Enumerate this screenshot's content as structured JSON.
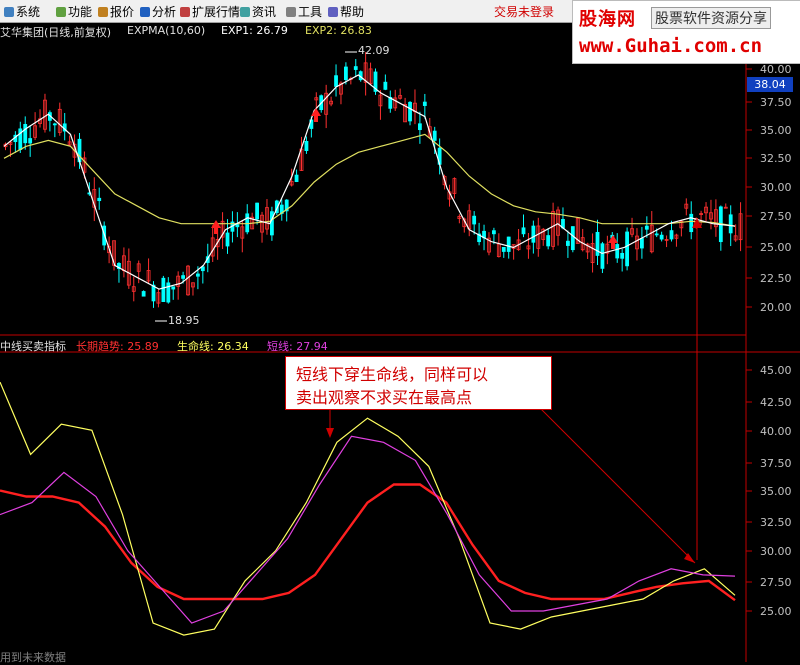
{
  "menu": {
    "items": [
      {
        "label": "系统",
        "icon": "system-icon"
      },
      {
        "label": "功能",
        "icon": "function-icon"
      },
      {
        "label": "报价",
        "icon": "quote-icon"
      },
      {
        "label": "分析",
        "icon": "analysis-icon"
      },
      {
        "label": "扩展行情",
        "icon": "extended-quote-icon"
      },
      {
        "label": "资讯",
        "icon": "news-icon"
      },
      {
        "label": "工具",
        "icon": "tools-icon"
      },
      {
        "label": "帮助",
        "icon": "help-icon"
      }
    ],
    "trade_status": "交易未登录"
  },
  "watermark": {
    "brand": "股海网",
    "tagline": "股票软件资源分享",
    "url": "www.Guhai.com.cn"
  },
  "main_panel": {
    "title": "艾华集团(日线,前复权)",
    "ema_label": "EXPMA(10,60)",
    "exp1": "EXP1: 26.79",
    "exp2": "EXP2: 26.83",
    "high_label": "42.09",
    "low_label": "18.95",
    "current_price": "38.04",
    "y_ticks": [
      "40.00",
      "37.50",
      "35.00",
      "32.50",
      "30.00",
      "27.50",
      "25.00",
      "22.50",
      "20.00"
    ]
  },
  "indicator_panel": {
    "title": "中线买卖指标",
    "long_label": "长期趋势: 25.89",
    "life_label": "生命线: 26.34",
    "short_label": "短线: 27.94",
    "y_ticks": [
      "45.00",
      "42.50",
      "40.00",
      "37.50",
      "35.00",
      "32.50",
      "30.00",
      "27.50",
      "25.00"
    ],
    "annotation_line1": "短线下穿生命线，同样可以",
    "annotation_line2": "卖出观察不求买在最高点"
  },
  "bottom_hint": "用到未来数据",
  "colors": {
    "up": "#ff3030",
    "down": "#00ffff",
    "ema1": "#ffffff",
    "ema2": "#e0e060",
    "long": "#ff2020",
    "life": "#ffff60",
    "short": "#e040e0",
    "axis": "#c00000"
  },
  "chart_data": {
    "type": "line",
    "note_series": [
      {
        "name": "EXP1",
        "values": [
          33.5,
          35.0,
          36.2,
          34.5,
          29.0,
          23.5,
          22.5,
          21.5,
          22.0,
          23.5,
          26.5,
          27.5,
          27.0,
          31.0,
          36.5,
          38.5,
          39.5,
          38.0,
          37.0,
          36.0,
          30.0,
          26.5,
          25.5,
          25.0,
          26.0,
          27.0,
          25.5,
          24.5,
          25.0,
          26.0,
          27.0,
          27.5,
          27.0,
          26.8
        ]
      },
      {
        "name": "EXP2",
        "values": [
          32.5,
          33.5,
          34.0,
          33.5,
          31.5,
          29.5,
          28.5,
          27.5,
          27.0,
          27.0,
          27.0,
          27.0,
          27.2,
          28.5,
          30.5,
          32.0,
          33.0,
          33.5,
          34.0,
          34.5,
          33.0,
          31.0,
          29.5,
          28.5,
          28.0,
          27.8,
          27.5,
          27.0,
          27.0,
          27.0,
          27.0,
          27.2,
          27.1,
          26.8
        ]
      },
      {
        "name": "长期趋势",
        "values": [
          35.0,
          34.5,
          34.5,
          34.0,
          32.0,
          29.0,
          27.0,
          26.0,
          26.0,
          26.0,
          26.0,
          26.5,
          28.0,
          31.0,
          34.0,
          35.5,
          35.5,
          34.0,
          30.5,
          27.5,
          26.5,
          26.0,
          26.0,
          26.0,
          26.5,
          27.0,
          27.3,
          27.5,
          25.9
        ]
      },
      {
        "name": "生命线",
        "values": [
          44.0,
          38.0,
          40.5,
          40.0,
          33.0,
          24.0,
          23.0,
          23.5,
          27.5,
          30.0,
          34.0,
          39.0,
          41.0,
          39.5,
          37.0,
          31.0,
          24.0,
          23.5,
          24.5,
          25.0,
          25.5,
          26.0,
          27.5,
          28.5,
          26.3
        ]
      },
      {
        "name": "短线",
        "values": [
          33.0,
          34.0,
          36.5,
          34.5,
          30.0,
          27.0,
          24.0,
          25.0,
          28.0,
          31.0,
          35.5,
          39.5,
          39.0,
          37.5,
          33.0,
          28.0,
          25.0,
          25.0,
          25.5,
          26.0,
          27.5,
          28.5,
          28.0,
          27.9
        ]
      }
    ]
  }
}
